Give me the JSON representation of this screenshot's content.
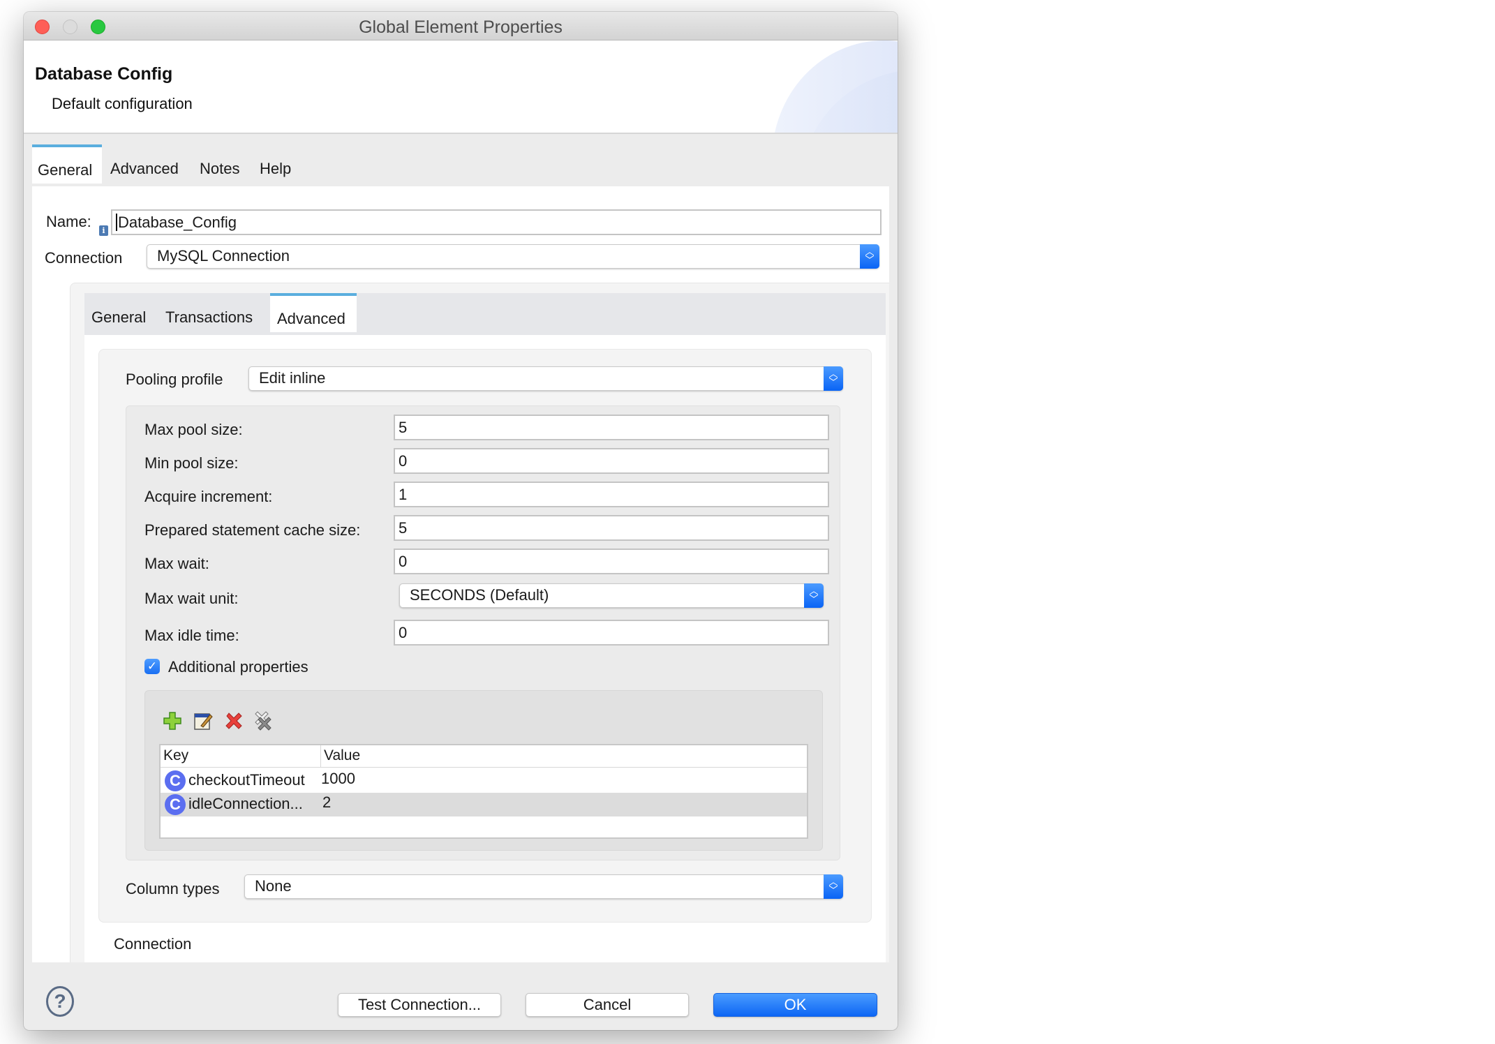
{
  "window": {
    "title": "Global Element Properties"
  },
  "header": {
    "title": "Database Config",
    "description": "Default configuration"
  },
  "outer_tabs": [
    {
      "label": "General",
      "active": true
    },
    {
      "label": "Advanced",
      "active": false
    },
    {
      "label": "Notes",
      "active": false
    },
    {
      "label": "Help",
      "active": false
    }
  ],
  "name_field": {
    "label": "Name:",
    "value": "Database_Config",
    "info_icon": "info-icon"
  },
  "connection_field": {
    "label": "Connection",
    "selected": "MySQL Connection"
  },
  "inner_tabs": [
    {
      "label": "General",
      "active": false
    },
    {
      "label": "Transactions",
      "active": false
    },
    {
      "label": "Advanced",
      "active": true
    }
  ],
  "pooling": {
    "label": "Pooling profile",
    "selected": "Edit inline",
    "fields": [
      {
        "label": "Max pool size:",
        "value": "5"
      },
      {
        "label": "Min pool size:",
        "value": "0"
      },
      {
        "label": "Acquire increment:",
        "value": "1"
      },
      {
        "label": "Prepared statement cache size:",
        "value": "5"
      },
      {
        "label": "Max wait:",
        "value": "0"
      }
    ],
    "max_wait_unit": {
      "label": "Max wait unit:",
      "selected": "SECONDS (Default)"
    },
    "max_idle_time": {
      "label": "Max idle time:",
      "value": "0"
    },
    "additional_properties": {
      "label": "Additional properties",
      "checked": true,
      "toolbar": [
        "add-icon",
        "edit-icon",
        "delete-icon",
        "delete-all-icon"
      ],
      "columns": [
        "Key",
        "Value"
      ],
      "rows": [
        {
          "key": "checkoutTimeout",
          "value": "1000",
          "selected": false
        },
        {
          "key": "idleConnection...",
          "value": "2",
          "selected": true
        }
      ]
    }
  },
  "column_types": {
    "label": "Column types",
    "selected": "None"
  },
  "connection_section": {
    "label": "Connection"
  },
  "footer": {
    "test_connection": "Test Connection...",
    "cancel": "Cancel",
    "ok": "OK"
  },
  "colors": {
    "accent": "#0d66f4",
    "tab_indicator": "#5aaede",
    "close": "#fe5f57",
    "maximize": "#28c840"
  }
}
